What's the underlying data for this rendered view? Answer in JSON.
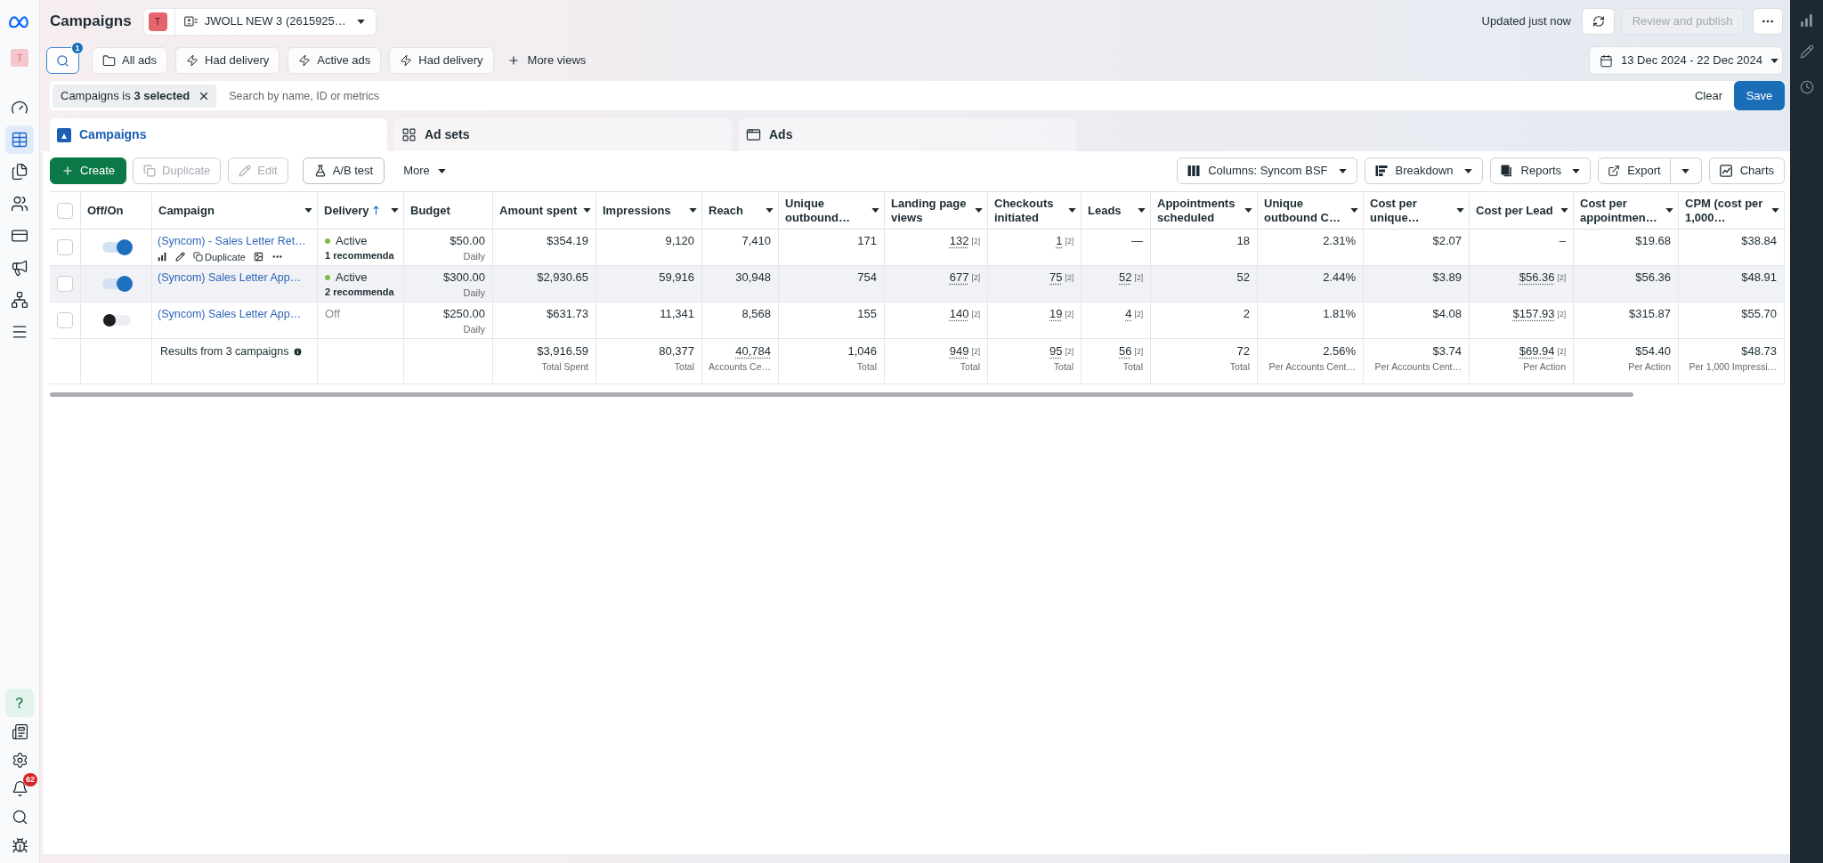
{
  "sidebar": {
    "avatar": "T",
    "nav": [
      {
        "selected": false
      },
      {
        "selected": true
      },
      {
        "selected": false
      },
      {
        "selected": false
      },
      {
        "selected": false
      },
      {
        "selected": false
      },
      {
        "selected": false
      },
      {
        "selected": false
      }
    ],
    "notifications": "62"
  },
  "header": {
    "title": "Campaigns",
    "account": {
      "avatar": "T",
      "name": "JWOLL NEW 3 (2615925…"
    },
    "status": "Updated just now",
    "publish": {
      "label": "Review and publish",
      "disabled": true
    }
  },
  "views": {
    "search": {
      "badge": "1",
      "active": true
    },
    "items": [
      {
        "kind": "folder",
        "label": "All ads"
      },
      {
        "kind": "bolt",
        "label": "Had delivery"
      },
      {
        "kind": "bolt",
        "label": "Active ads"
      },
      {
        "kind": "bolt",
        "label": "Had delivery"
      }
    ],
    "more": "More views",
    "date_range": "13 Dec 2024 - 22 Dec 2024"
  },
  "filter": {
    "chip": "Campaigns is **3 selected**",
    "placeholder": "Search by name, ID or metrics",
    "clear": "Clear",
    "save": "Save"
  },
  "tabs": [
    {
      "kind": "campaigns",
      "label": "Campaigns",
      "selected": true
    },
    {
      "kind": "adsets",
      "label": "Ad sets",
      "selected": false
    },
    {
      "kind": "ads",
      "label": "Ads",
      "selected": false
    }
  ],
  "toolbar": {
    "left": [
      {
        "kind": "create",
        "label": "Create",
        "disabled": false
      },
      {
        "kind": "duplicate",
        "label": "Duplicate",
        "disabled": true
      },
      {
        "kind": "edit",
        "label": "Edit",
        "disabled": true
      },
      {
        "kind": "abtest",
        "label": "A/B test",
        "disabled": false
      },
      {
        "kind": "more",
        "label": "More",
        "disabled": false
      }
    ],
    "right": [
      {
        "kind": "columns",
        "label": "Columns: Syncom BSF"
      },
      {
        "kind": "breakdown",
        "label": "Breakdown"
      },
      {
        "kind": "reports",
        "label": "Reports"
      },
      {
        "kind": "export",
        "label": "Export"
      },
      {
        "kind": "charts",
        "label": "Charts"
      }
    ]
  },
  "table": {
    "all_checked": false,
    "columns": [
      {
        "label": "Off/On",
        "menu": false,
        "sorted": false
      },
      {
        "label": "Campaign",
        "menu": true,
        "sorted": false
      },
      {
        "label": "Delivery",
        "menu": true,
        "sorted": true
      },
      {
        "label": "Budget",
        "menu": false,
        "sorted": false
      }
    ],
    "metric_columns": [
      {
        "label": "Amount spent",
        "menu": true,
        "sorted": false
      },
      {
        "label": "Impressions",
        "menu": true,
        "sorted": false
      },
      {
        "label": "Reach",
        "menu": true,
        "sorted": false
      },
      {
        "label": "Unique outbound…",
        "menu": true,
        "sorted": false
      },
      {
        "label": "Landing page views",
        "menu": true,
        "sorted": false
      },
      {
        "label": "Checkouts initiated",
        "menu": true,
        "sorted": false
      },
      {
        "label": "Leads",
        "menu": true,
        "sorted": false
      },
      {
        "label": "Appointments scheduled",
        "menu": true,
        "sorted": false
      },
      {
        "label": "Unique outbound C…",
        "menu": true,
        "sorted": false
      },
      {
        "label": "Cost per unique…",
        "menu": true,
        "sorted": false
      },
      {
        "label": "Cost per Lead",
        "menu": true,
        "sorted": false
      },
      {
        "label": "Cost per appointmen…",
        "menu": true,
        "sorted": false
      },
      {
        "label": "CPM (cost per 1,000…",
        "menu": true,
        "sorted": false
      }
    ],
    "rows": [
      {
        "checked": false,
        "on": true,
        "highlighted": false,
        "name": "(Syncom) - Sales Letter Ret…",
        "hover_actions": {
          "duplicate": "Duplicate"
        },
        "delivery": {
          "label": "Active",
          "active": true,
          "note": "1 recommenda"
        },
        "budget": {
          "value": "$50.00",
          "period": "Daily"
        },
        "metrics": [
          {
            "value": "$354.19",
            "dotted": false
          },
          {
            "value": "9,120",
            "dotted": false
          },
          {
            "value": "7,410",
            "dotted": false
          },
          {
            "value": "171",
            "dotted": false
          },
          {
            "value": "132",
            "note": "[2]",
            "dotted": true
          },
          {
            "value": "1",
            "note": "[2]",
            "dotted": true
          },
          {
            "value": "—",
            "dotted": false
          },
          {
            "value": "18",
            "dotted": false
          },
          {
            "value": "2.31%",
            "dotted": false
          },
          {
            "value": "$2.07",
            "dotted": false
          },
          {
            "value": "–",
            "dotted": false
          },
          {
            "value": "$19.68",
            "dotted": false
          },
          {
            "value": "$38.84",
            "dotted": false
          }
        ]
      },
      {
        "checked": false,
        "on": true,
        "highlighted": true,
        "name": "(Syncom) Sales Letter App…",
        "delivery": {
          "label": "Active",
          "active": true,
          "note": "2 recommenda"
        },
        "budget": {
          "value": "$300.00",
          "period": "Daily"
        },
        "metrics": [
          {
            "value": "$2,930.65",
            "dotted": false
          },
          {
            "value": "59,916",
            "dotted": false
          },
          {
            "value": "30,948",
            "dotted": false
          },
          {
            "value": "754",
            "dotted": false
          },
          {
            "value": "677",
            "note": "[2]",
            "dotted": true
          },
          {
            "value": "75",
            "note": "[2]",
            "dotted": true
          },
          {
            "value": "52",
            "note": "[2]",
            "dotted": true
          },
          {
            "value": "52",
            "dotted": false
          },
          {
            "value": "2.44%",
            "dotted": false
          },
          {
            "value": "$3.89",
            "dotted": false
          },
          {
            "value": "$56.36",
            "note": "[2]",
            "dotted": true
          },
          {
            "value": "$56.36",
            "dotted": false
          },
          {
            "value": "$48.91",
            "dotted": false
          }
        ]
      },
      {
        "checked": false,
        "on": false,
        "highlighted": false,
        "name": "(Syncom) Sales Letter App…",
        "delivery": {
          "label": "Off",
          "active": false
        },
        "budget": {
          "value": "$250.00",
          "period": "Daily"
        },
        "metrics": [
          {
            "value": "$631.73",
            "dotted": false
          },
          {
            "value": "11,341",
            "dotted": false
          },
          {
            "value": "8,568",
            "dotted": false
          },
          {
            "value": "155",
            "dotted": false
          },
          {
            "value": "140",
            "note": "[2]",
            "dotted": true
          },
          {
            "value": "19",
            "note": "[2]",
            "dotted": true
          },
          {
            "value": "4",
            "note": "[2]",
            "dotted": true
          },
          {
            "value": "2",
            "dotted": false
          },
          {
            "value": "1.81%",
            "dotted": false
          },
          {
            "value": "$4.08",
            "dotted": false
          },
          {
            "value": "$157.93",
            "note": "[2]",
            "dotted": true
          },
          {
            "value": "$315.87",
            "dotted": false
          },
          {
            "value": "$55.70",
            "dotted": false
          }
        ]
      }
    ],
    "total": {
      "label": "Results from 3 campaigns",
      "metrics": [
        {
          "value": "$3,916.59",
          "sub": "Total Spent",
          "dotted": false
        },
        {
          "value": "80,377",
          "sub": "Total",
          "dotted": false
        },
        {
          "value": "40,784",
          "sub": "Accounts Ce…",
          "dotted": true
        },
        {
          "value": "1,046",
          "sub": "Total",
          "dotted": false
        },
        {
          "value": "949",
          "note": "[2]",
          "sub": "Total",
          "dotted": true
        },
        {
          "value": "95",
          "note": "[2]",
          "sub": "Total",
          "dotted": true
        },
        {
          "value": "56",
          "note": "[2]",
          "sub": "Total",
          "dotted": true
        },
        {
          "value": "72",
          "sub": "Total",
          "dotted": false
        },
        {
          "value": "2.56%",
          "sub": "Per Accounts Cent…",
          "dotted": false
        },
        {
          "value": "$3.74",
          "sub": "Per Accounts Cent…",
          "dotted": false
        },
        {
          "value": "$69.94",
          "note": "[2]",
          "sub": "Per Action",
          "dotted": true
        },
        {
          "value": "$54.40",
          "sub": "Per Action",
          "dotted": false
        },
        {
          "value": "$48.73",
          "sub": "Per 1,000 Impressi…",
          "dotted": false
        }
      ]
    }
  }
}
